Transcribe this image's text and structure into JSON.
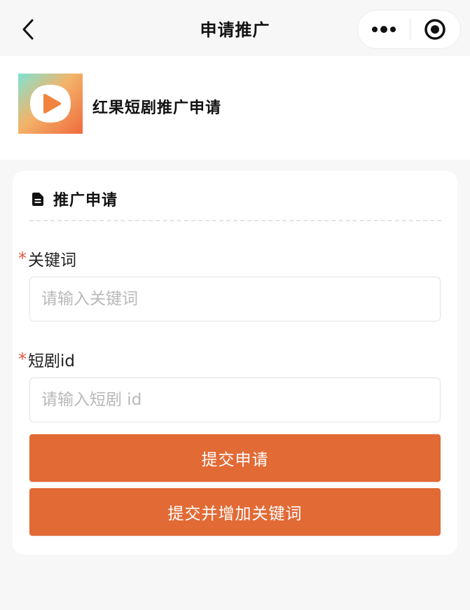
{
  "navbar": {
    "title": "申请推广",
    "back_icon": "chevron-left-icon",
    "more_icon": "more-dots-icon",
    "close_icon": "target-close-icon"
  },
  "app": {
    "name": "红果短剧推广申请",
    "logo_icon": "play-logo-icon",
    "logo_colors": [
      "#7ee3d2",
      "#f2b46a",
      "#f06a3c"
    ]
  },
  "form": {
    "section_title": "推广申请",
    "section_icon": "document-icon",
    "required_mark": "*",
    "keyword": {
      "label": "关键词",
      "value": "",
      "placeholder": "请输入关键词"
    },
    "drama_id": {
      "label": "短剧id",
      "value": "",
      "placeholder": "请输入短剧 id"
    },
    "submit_label": "提交申请",
    "submit_add_label": "提交并增加关键词"
  },
  "colors": {
    "accent": "#e26a35",
    "required": "#e4573f",
    "background": "#f7f7f7"
  }
}
